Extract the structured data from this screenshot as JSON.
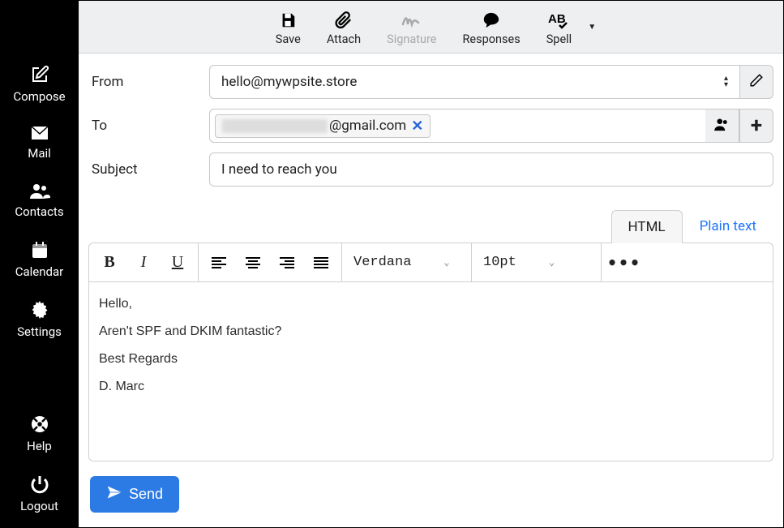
{
  "sidebar": {
    "items": [
      {
        "id": "compose",
        "label": "Compose",
        "icon": "edit-icon"
      },
      {
        "id": "mail",
        "label": "Mail",
        "icon": "envelope-icon"
      },
      {
        "id": "contacts",
        "label": "Contacts",
        "icon": "users-icon"
      },
      {
        "id": "calendar",
        "label": "Calendar",
        "icon": "calendar-icon"
      },
      {
        "id": "settings",
        "label": "Settings",
        "icon": "gear-icon"
      }
    ],
    "bottom": [
      {
        "id": "help",
        "label": "Help",
        "icon": "lifebuoy-icon"
      },
      {
        "id": "logout",
        "label": "Logout",
        "icon": "power-icon"
      }
    ]
  },
  "toolbar": {
    "save": "Save",
    "attach": "Attach",
    "signature": "Signature",
    "responses": "Responses",
    "spell": "Spell"
  },
  "form": {
    "from_label": "From",
    "from_value": "hello@mywpsite.store",
    "to_label": "To",
    "to_value_suffix": "@gmail.com",
    "subject_label": "Subject",
    "subject_value": "I need to reach you"
  },
  "editor": {
    "tabs": {
      "html": "HTML",
      "plain": "Plain text",
      "active": "html"
    },
    "font_family": "Verdana",
    "font_size": "10pt",
    "body_lines": [
      "Hello,",
      "Aren't SPF and DKIM fantastic?",
      "Best Regards",
      "D. Marc"
    ]
  },
  "actions": {
    "send": "Send"
  }
}
